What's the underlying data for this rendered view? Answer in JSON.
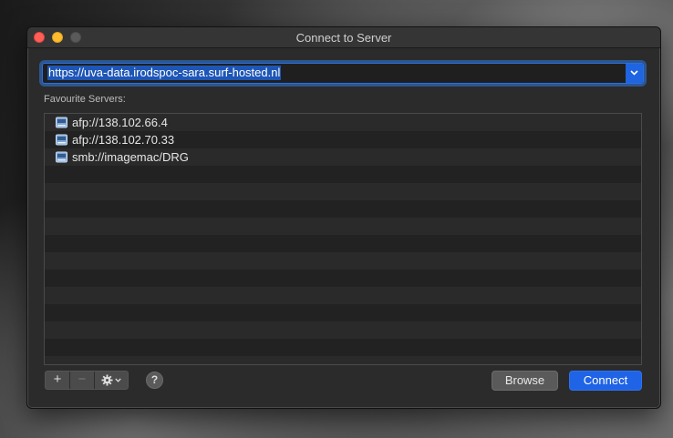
{
  "window": {
    "title": "Connect to Server"
  },
  "address": {
    "value": "https://uva-data.irodspoc-sara.surf-hosted.nl"
  },
  "favourites": {
    "label": "Favourite Servers:",
    "items": [
      {
        "label": "afp://138.102.66.4",
        "icon": "network-drive-icon"
      },
      {
        "label": "afp://138.102.70.33",
        "icon": "network-drive-icon"
      },
      {
        "label": "smb://imagemac/DRG",
        "icon": "network-drive-icon"
      }
    ]
  },
  "toolbar": {
    "add_label": "+",
    "remove_label": "−",
    "help_label": "?"
  },
  "buttons": {
    "browse_label": "Browse",
    "connect_label": "Connect"
  },
  "colors": {
    "accent": "#1f63e6",
    "close": "#ff5f57",
    "minimize": "#febc2e"
  }
}
